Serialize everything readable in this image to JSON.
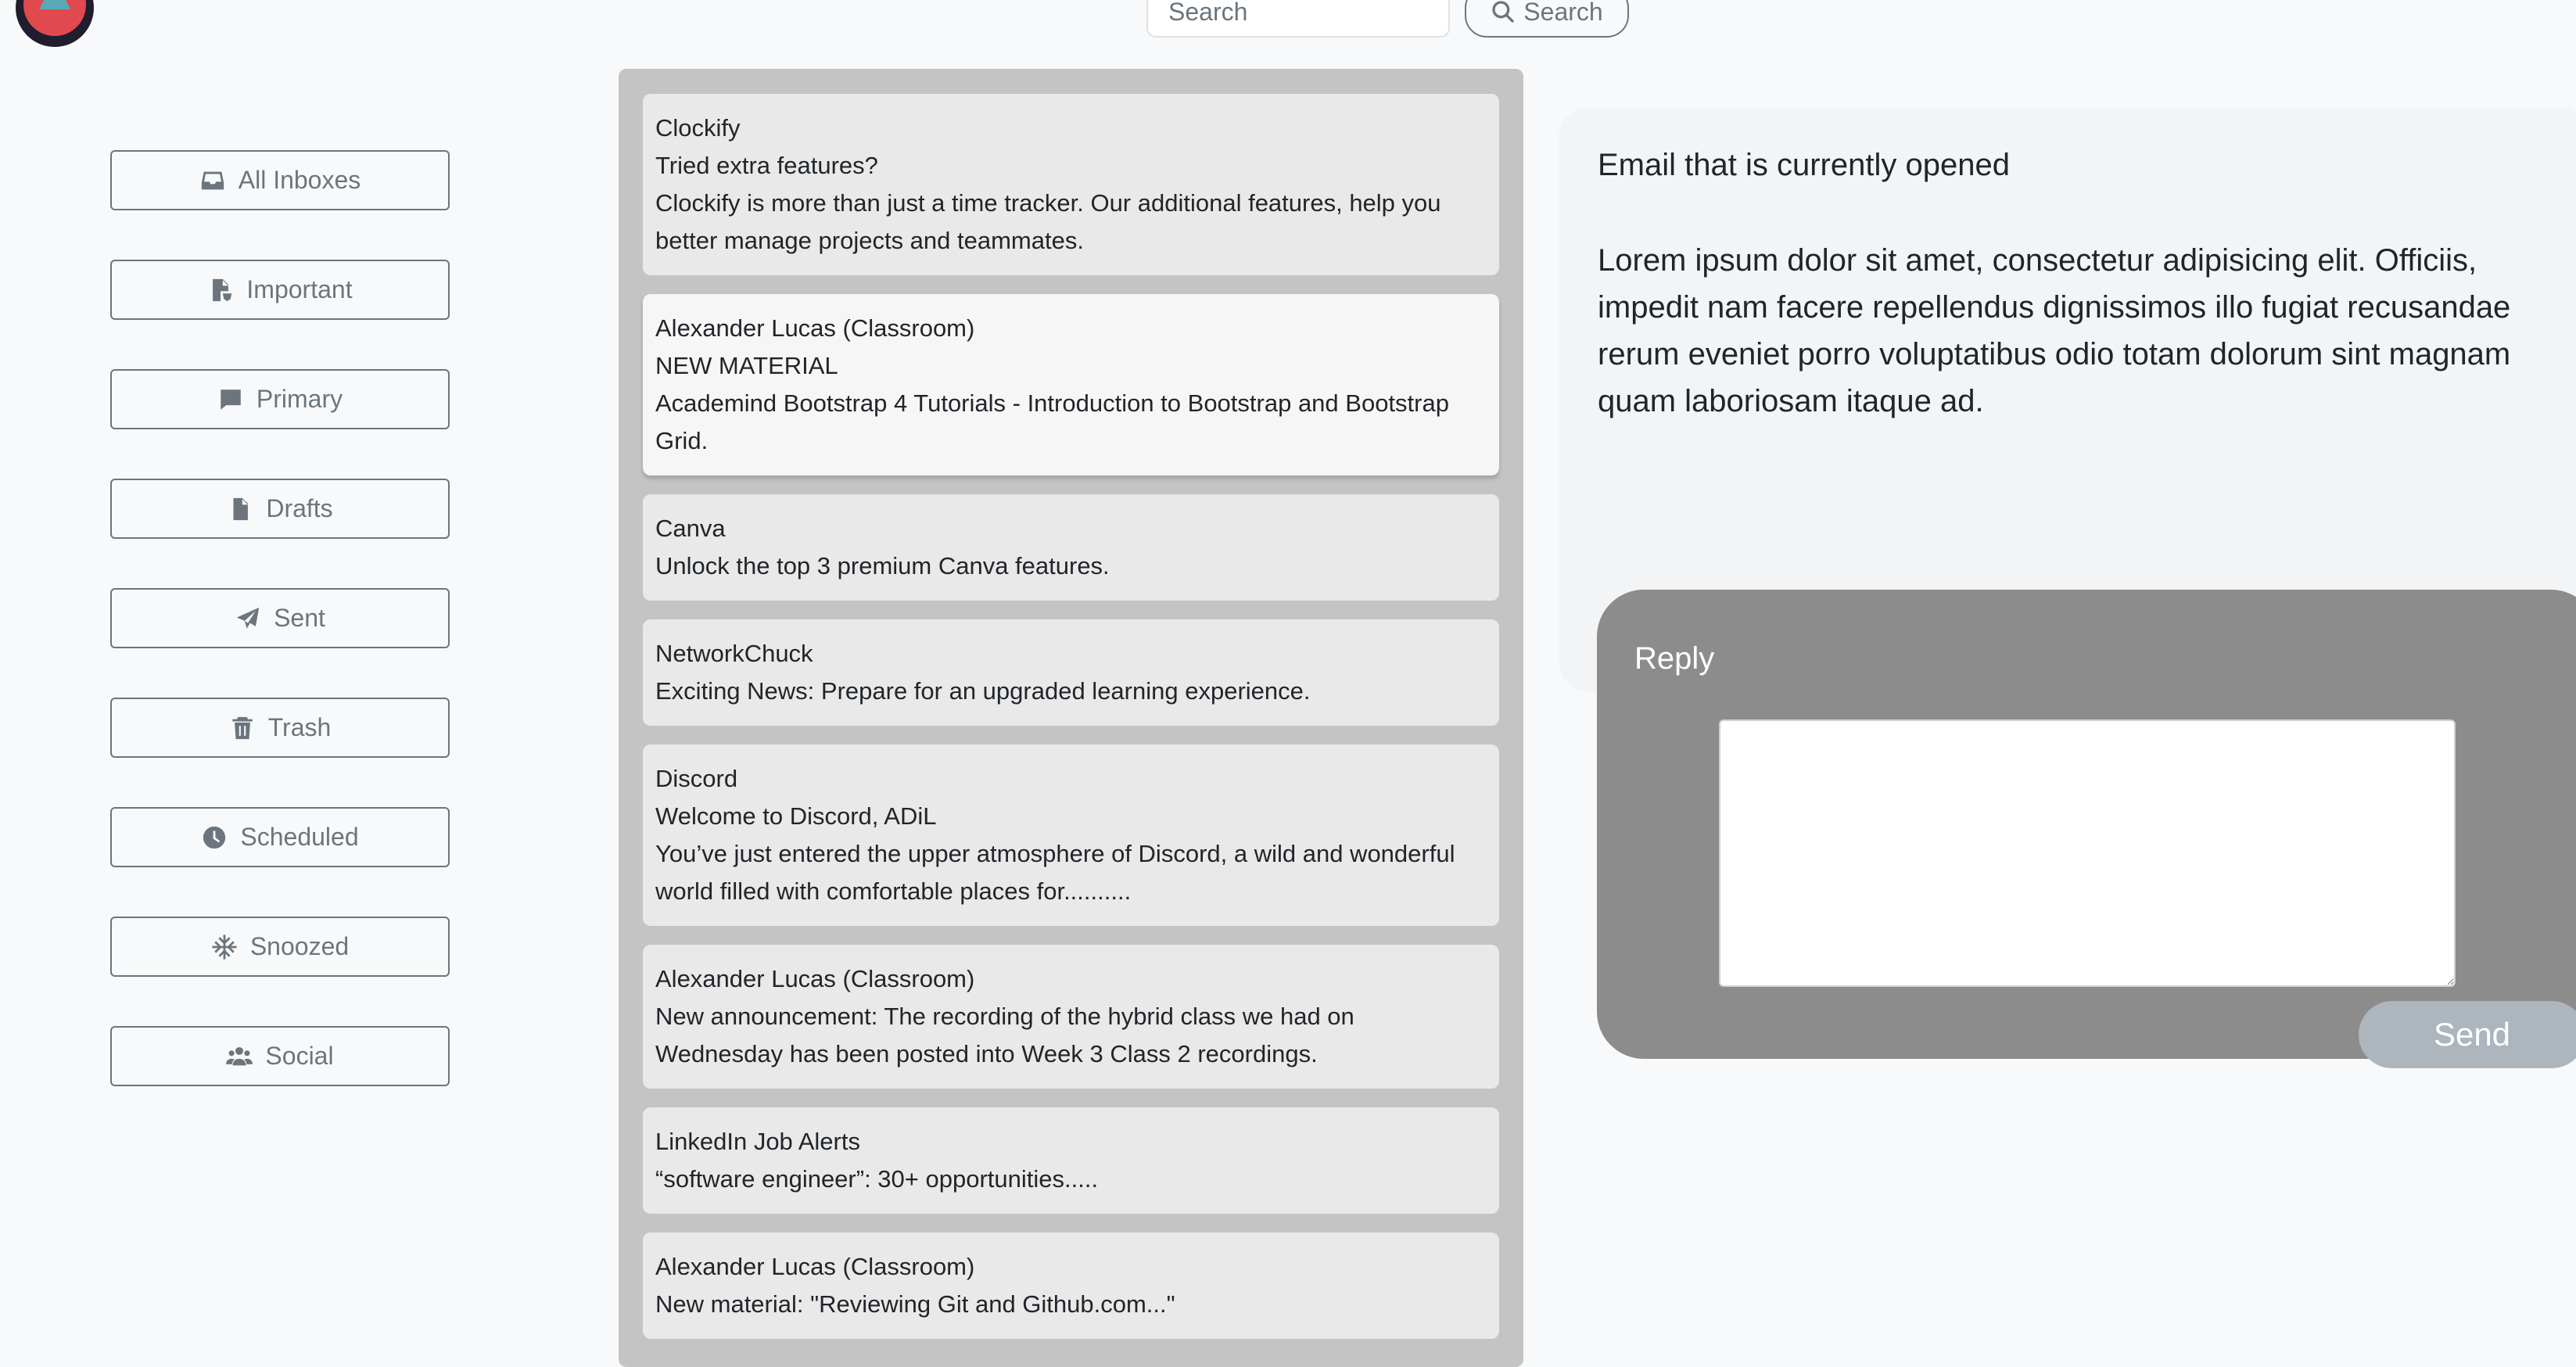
{
  "header": {
    "search_placeholder": "Search",
    "search_button_label": "Search"
  },
  "sidebar": {
    "items": [
      {
        "label": "All Inboxes",
        "icon": "inbox-icon"
      },
      {
        "label": "Important",
        "icon": "important-file-icon"
      },
      {
        "label": "Primary",
        "icon": "message-icon"
      },
      {
        "label": "Drafts",
        "icon": "file-icon"
      },
      {
        "label": "Sent",
        "icon": "paper-plane-icon"
      },
      {
        "label": "Trash",
        "icon": "trash-icon"
      },
      {
        "label": "Scheduled",
        "icon": "clock-icon"
      },
      {
        "label": "Snoozed",
        "icon": "snowflake-icon"
      },
      {
        "label": "Social",
        "icon": "users-icon"
      }
    ]
  },
  "emails": [
    {
      "sender": "Clockify",
      "subject": "Tried extra features?",
      "preview": "Clockify is more than just a time tracker. Our additional features, help you better manage projects and teammates."
    },
    {
      "sender": "Alexander Lucas (Classroom)",
      "subject": "NEW MATERIAL",
      "preview": "Academind Bootstrap 4 Tutorials - Introduction to Bootstrap and Bootstrap Grid."
    },
    {
      "sender": "Canva",
      "subject": "Unlock the top 3 premium Canva features."
    },
    {
      "sender": "NetworkChuck",
      "subject": "Exciting News: Prepare for an upgraded learning experience."
    },
    {
      "sender": "Discord",
      "subject": "Welcome to Discord, ADiL",
      "preview": "You’ve just entered the upper atmosphere of Discord, a wild and wonderful world filled with comfortable places for.........."
    },
    {
      "sender": "Alexander Lucas (Classroom)",
      "subject": "New announcement: The recording of the hybrid class we had on Wednesday has been posted into Week 3 Class 2 recordings."
    },
    {
      "sender": "LinkedIn Job Alerts",
      "subject": "“software engineer”: 30+ opportunities....."
    },
    {
      "sender": "Alexander Lucas (Classroom)",
      "subject": "New material: \"Reviewing Git and Github.com...\""
    }
  ],
  "reader": {
    "title": "Email that is currently opened",
    "body": "Lorem ipsum dolor sit amet, consectetur adipisicing elit. Officiis, impedit nam facere repellendus dignissimos illo fugiat recusandae rerum eveniet porro voluptatibus odio totam dolorum sint magnam quam laboriosam itaque ad."
  },
  "reply": {
    "label": "Reply",
    "textarea_value": "",
    "send_label": "Send"
  }
}
